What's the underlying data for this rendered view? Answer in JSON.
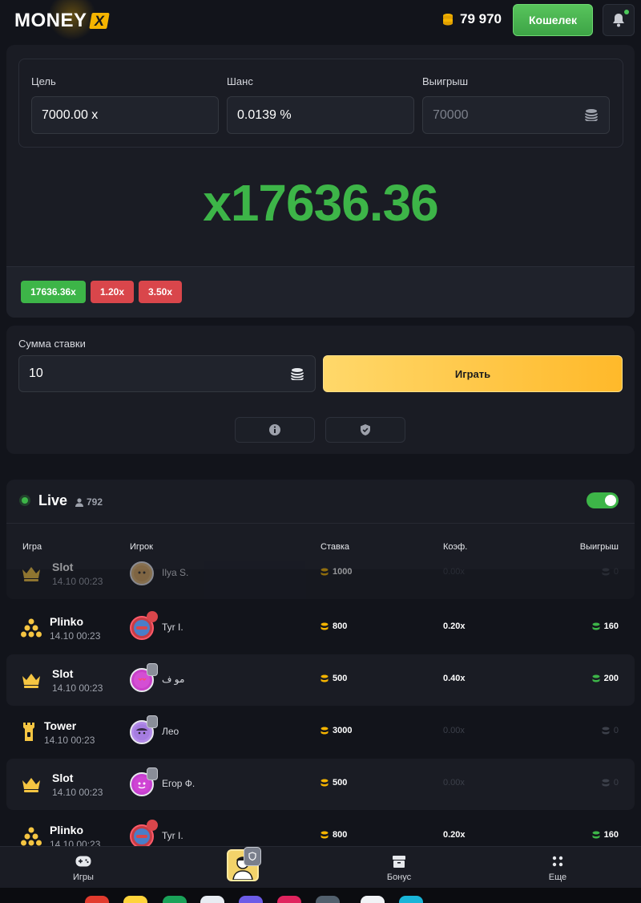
{
  "header": {
    "logo_text": "MONEY",
    "logo_x": "X",
    "balance": "79 970",
    "wallet_label": "Кошелек"
  },
  "game": {
    "target_label": "Цель",
    "target_value": "7000.00 x",
    "chance_label": "Шанс",
    "chance_value": "0.0139 %",
    "payout_label": "Выигрыш",
    "payout_value": "70000",
    "multiplier": "x17636.36",
    "history": [
      "17636.36x",
      "1.20x",
      "3.50x"
    ],
    "history_colors": [
      "#3db548",
      "#d9464b",
      "#d9464b"
    ]
  },
  "bet": {
    "label": "Сумма ставки",
    "value": "10",
    "play_label": "Играть"
  },
  "live": {
    "title": "Live",
    "online_count": "792",
    "toggle_on": true,
    "columns": [
      "Игра",
      "Игрок",
      "Ставка",
      "Коэф.",
      "Выигрыш"
    ]
  },
  "rows": [
    {
      "game": "Slot",
      "time": "14.10 00:23",
      "player": "Ilya S.",
      "stake": "1000",
      "coef": "0.00x",
      "win": "0",
      "won": false
    },
    {
      "game": "Plinko",
      "time": "14.10 00:23",
      "player": "Tyr I.",
      "stake": "800",
      "coef": "0.20x",
      "win": "160",
      "won": true
    },
    {
      "game": "Slot",
      "time": "14.10 00:23",
      "player": "مو ف",
      "stake": "500",
      "coef": "0.40x",
      "win": "200",
      "won": true
    },
    {
      "game": "Tower",
      "time": "14.10 00:23",
      "player": "Лео",
      "stake": "3000",
      "coef": "0.00x",
      "win": "0",
      "won": false
    },
    {
      "game": "Slot",
      "time": "14.10 00:23",
      "player": "Егор Ф.",
      "stake": "500",
      "coef": "0.00x",
      "win": "0",
      "won": false
    },
    {
      "game": "Plinko",
      "time": "14.10 00:23",
      "player": "Tyr I.",
      "stake": "800",
      "coef": "0.20x",
      "win": "160",
      "won": true
    }
  ],
  "nav": {
    "games": "Игры",
    "bonus": "Бонус",
    "more": "Еще"
  },
  "colors": {
    "accent_green": "#3db548",
    "accent_red": "#d9464b",
    "accent_gold": "#ffc23a",
    "background": "#12141b",
    "panel": "#1a1c24"
  },
  "icons": {
    "coin": "coin-stack-icon",
    "bell": "bell-icon",
    "info": "info-icon",
    "shield": "shield-check-icon",
    "user": "user-icon",
    "gamepad": "gamepad-icon",
    "bonus": "gift-box-icon",
    "more": "dots-grid-icon"
  }
}
